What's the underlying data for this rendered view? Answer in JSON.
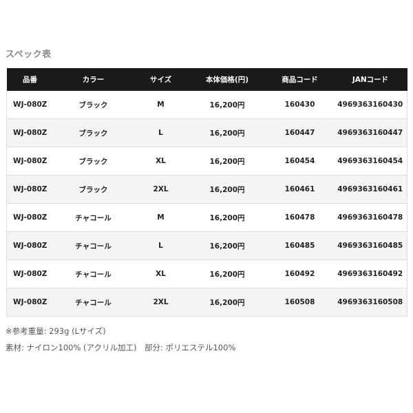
{
  "title": "スペック表",
  "table": {
    "headers": [
      "品番",
      "カラー",
      "サイズ",
      "本体価格(円)",
      "商品コード",
      "JANコード"
    ],
    "rows": [
      [
        "WJ-080Z",
        "ブラック",
        "M",
        "16,200円",
        "160430",
        "4969363160430"
      ],
      [
        "WJ-080Z",
        "ブラック",
        "L",
        "16,200円",
        "160447",
        "4969363160447"
      ],
      [
        "WJ-080Z",
        "ブラック",
        "XL",
        "16,200円",
        "160454",
        "4969363160454"
      ],
      [
        "WJ-080Z",
        "ブラック",
        "2XL",
        "16,200円",
        "160461",
        "4969363160461"
      ],
      [
        "WJ-080Z",
        "チャコール",
        "M",
        "16,200円",
        "160478",
        "4969363160478"
      ],
      [
        "WJ-080Z",
        "チャコール",
        "L",
        "16,200円",
        "160485",
        "4969363160485"
      ],
      [
        "WJ-080Z",
        "チャコール",
        "XL",
        "16,200円",
        "160492",
        "4969363160492"
      ],
      [
        "WJ-080Z",
        "チャコール",
        "2XL",
        "16,200円",
        "160508",
        "4969363160508"
      ]
    ]
  },
  "notes": {
    "weight": "※参考重量: 293g (Lサイズ)",
    "material": "素材: ナイロン100% (アクリル加工)　部分: ポリエステル100%"
  },
  "colors": {
    "header_bg": "#1a1a1a",
    "header_text": "#ffffff",
    "stripe": "#f4f4f4"
  }
}
